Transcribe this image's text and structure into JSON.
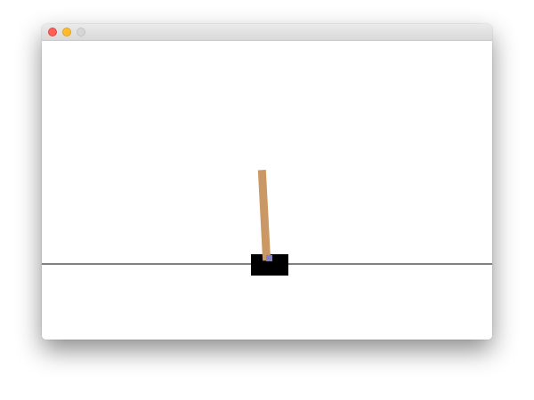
{
  "window": {
    "title": "",
    "buttons": [
      {
        "name": "close",
        "color": "#ff5f57"
      },
      {
        "name": "minimize",
        "color": "#febc2e"
      },
      {
        "name": "zoom",
        "color": "#d6d6d6"
      }
    ]
  },
  "scene": {
    "background_color": "#ffffff",
    "track_color": "#000000",
    "cart_color": "#000000",
    "pole_color": "#ca9865",
    "axle_color": "#8181cb",
    "pole_tilt_degrees": 3
  }
}
